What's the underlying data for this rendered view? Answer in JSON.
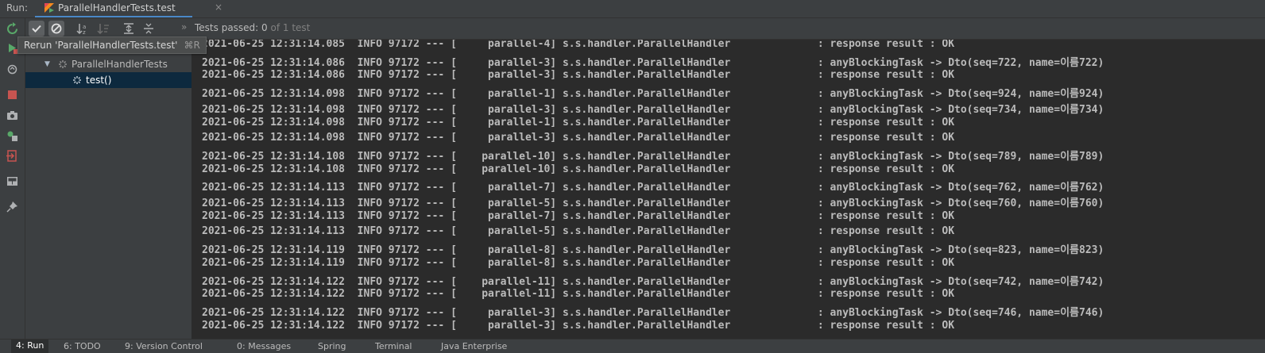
{
  "run": {
    "label": "Run:",
    "tab_title": "ParallelHandlerTests.test",
    "tab_close": "×"
  },
  "toolbar": {
    "chevron": "»",
    "status_label": "Tests passed:",
    "status_passed": "0",
    "status_total": "of 1 test"
  },
  "tooltip": {
    "text": "Rerun 'ParallelHandlerTests.test'",
    "shortcut": "⌘R"
  },
  "tree": {
    "items": [
      {
        "label": "ParallelHandlerTests"
      },
      {
        "label": "test()"
      }
    ]
  },
  "console": {
    "lines": [
      {
        "date": "2021-06-25",
        "time": "12:31:14.085",
        "level": "INFO",
        "pid": "97172",
        "thread": "parallel-4",
        "logger": "s.s.handler.ParallelHandler",
        "message": "response result : OK"
      },
      {
        "date": "2021-06-25",
        "time": "12:31:14.086",
        "level": "INFO",
        "pid": "97172",
        "thread": "parallel-3",
        "logger": "s.s.handler.ParallelHandler",
        "message": "anyBlockingTask -> Dto(seq=722, name=이름722)"
      },
      {
        "date": "2021-06-25",
        "time": "12:31:14.086",
        "level": "INFO",
        "pid": "97172",
        "thread": "parallel-3",
        "logger": "s.s.handler.ParallelHandler",
        "message": "response result : OK"
      },
      {
        "date": "2021-06-25",
        "time": "12:31:14.098",
        "level": "INFO",
        "pid": "97172",
        "thread": "parallel-1",
        "logger": "s.s.handler.ParallelHandler",
        "message": "anyBlockingTask -> Dto(seq=924, name=이름924)"
      },
      {
        "date": "2021-06-25",
        "time": "12:31:14.098",
        "level": "INFO",
        "pid": "97172",
        "thread": "parallel-3",
        "logger": "s.s.handler.ParallelHandler",
        "message": "anyBlockingTask -> Dto(seq=734, name=이름734)"
      },
      {
        "date": "2021-06-25",
        "time": "12:31:14.098",
        "level": "INFO",
        "pid": "97172",
        "thread": "parallel-1",
        "logger": "s.s.handler.ParallelHandler",
        "message": "response result : OK"
      },
      {
        "date": "2021-06-25",
        "time": "12:31:14.098",
        "level": "INFO",
        "pid": "97172",
        "thread": "parallel-3",
        "logger": "s.s.handler.ParallelHandler",
        "message": "response result : OK"
      },
      {
        "date": "2021-06-25",
        "time": "12:31:14.108",
        "level": "INFO",
        "pid": "97172",
        "thread": "parallel-10",
        "logger": "s.s.handler.ParallelHandler",
        "message": "anyBlockingTask -> Dto(seq=789, name=이름789)"
      },
      {
        "date": "2021-06-25",
        "time": "12:31:14.108",
        "level": "INFO",
        "pid": "97172",
        "thread": "parallel-10",
        "logger": "s.s.handler.ParallelHandler",
        "message": "response result : OK"
      },
      {
        "date": "2021-06-25",
        "time": "12:31:14.113",
        "level": "INFO",
        "pid": "97172",
        "thread": "parallel-7",
        "logger": "s.s.handler.ParallelHandler",
        "message": "anyBlockingTask -> Dto(seq=762, name=이름762)"
      },
      {
        "date": "2021-06-25",
        "time": "12:31:14.113",
        "level": "INFO",
        "pid": "97172",
        "thread": "parallel-5",
        "logger": "s.s.handler.ParallelHandler",
        "message": "anyBlockingTask -> Dto(seq=760, name=이름760)"
      },
      {
        "date": "2021-06-25",
        "time": "12:31:14.113",
        "level": "INFO",
        "pid": "97172",
        "thread": "parallel-7",
        "logger": "s.s.handler.ParallelHandler",
        "message": "response result : OK"
      },
      {
        "date": "2021-06-25",
        "time": "12:31:14.113",
        "level": "INFO",
        "pid": "97172",
        "thread": "parallel-5",
        "logger": "s.s.handler.ParallelHandler",
        "message": "response result : OK"
      },
      {
        "date": "2021-06-25",
        "time": "12:31:14.119",
        "level": "INFO",
        "pid": "97172",
        "thread": "parallel-8",
        "logger": "s.s.handler.ParallelHandler",
        "message": "anyBlockingTask -> Dto(seq=823, name=이름823)"
      },
      {
        "date": "2021-06-25",
        "time": "12:31:14.119",
        "level": "INFO",
        "pid": "97172",
        "thread": "parallel-8",
        "logger": "s.s.handler.ParallelHandler",
        "message": "response result : OK"
      },
      {
        "date": "2021-06-25",
        "time": "12:31:14.122",
        "level": "INFO",
        "pid": "97172",
        "thread": "parallel-11",
        "logger": "s.s.handler.ParallelHandler",
        "message": "anyBlockingTask -> Dto(seq=742, name=이름742)"
      },
      {
        "date": "2021-06-25",
        "time": "12:31:14.122",
        "level": "INFO",
        "pid": "97172",
        "thread": "parallel-11",
        "logger": "s.s.handler.ParallelHandler",
        "message": "response result : OK"
      },
      {
        "date": "2021-06-25",
        "time": "12:31:14.122",
        "level": "INFO",
        "pid": "97172",
        "thread": "parallel-3",
        "logger": "s.s.handler.ParallelHandler",
        "message": "anyBlockingTask -> Dto(seq=746, name=이름746)"
      },
      {
        "date": "2021-06-25",
        "time": "12:31:14.122",
        "level": "INFO",
        "pid": "97172",
        "thread": "parallel-3",
        "logger": "s.s.handler.ParallelHandler",
        "message": "response result : OK"
      }
    ]
  },
  "bottom_tabs": [
    {
      "label": "4: Run",
      "active": true
    },
    {
      "label": "6: TODO",
      "active": false
    },
    {
      "label": "9: Version Control",
      "active": false
    },
    {
      "label": "0: Messages",
      "active": false
    },
    {
      "label": "Spring",
      "active": false
    },
    {
      "label": "Terminal",
      "active": false
    },
    {
      "label": "Java Enterprise",
      "active": false
    }
  ],
  "colors": {
    "background": "#2b2b2b",
    "panel": "#3c3f41",
    "selection": "#0d293e",
    "accent": "#4a88c7",
    "text": "#bbbbbb",
    "rerun_green": "#59a869",
    "stop_red": "#c75450"
  },
  "icons": {
    "run_tab": "kotlin-run-icon",
    "left_toolbar": [
      "rerun-icon",
      "run-icon",
      "debug-toggle-icon",
      "stop-icon",
      "camera-icon",
      "export-icon",
      "exit-icon",
      "layout-icon",
      "pin-icon"
    ],
    "test_toolbar": [
      "show-passed-icon",
      "show-ignored-icon",
      "sort-alpha-icon",
      "sort-duration-icon",
      "expand-all-icon",
      "collapse-all-icon"
    ]
  }
}
